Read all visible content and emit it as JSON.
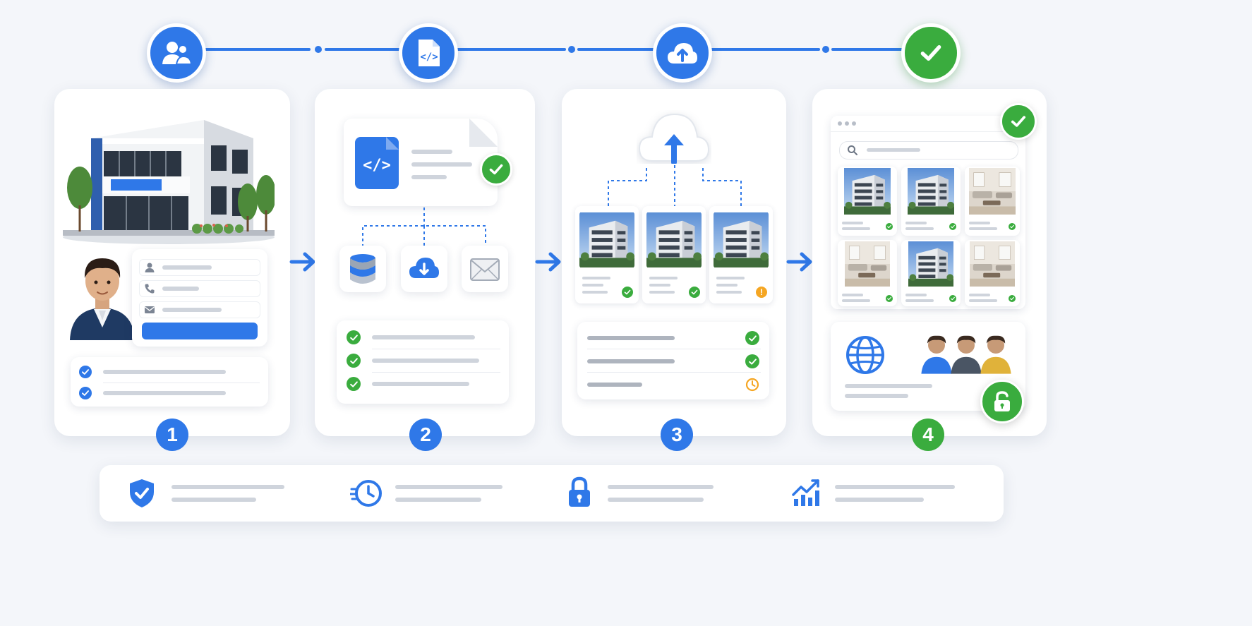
{
  "steps": [
    {
      "number": "1",
      "icon": "users-icon"
    },
    {
      "number": "2",
      "icon": "code-file-icon"
    },
    {
      "number": "3",
      "icon": "cloud-upload-icon"
    },
    {
      "number": "4",
      "icon": "check-icon"
    }
  ],
  "features": [
    {
      "icon": "shield-check-icon"
    },
    {
      "icon": "clock-fast-icon"
    },
    {
      "icon": "lock-icon"
    },
    {
      "icon": "growth-chart-icon"
    }
  ],
  "colors": {
    "accent": "#2f78e8",
    "success": "#3aac3e",
    "warning": "#f5a623",
    "background": "#f4f6fa"
  }
}
